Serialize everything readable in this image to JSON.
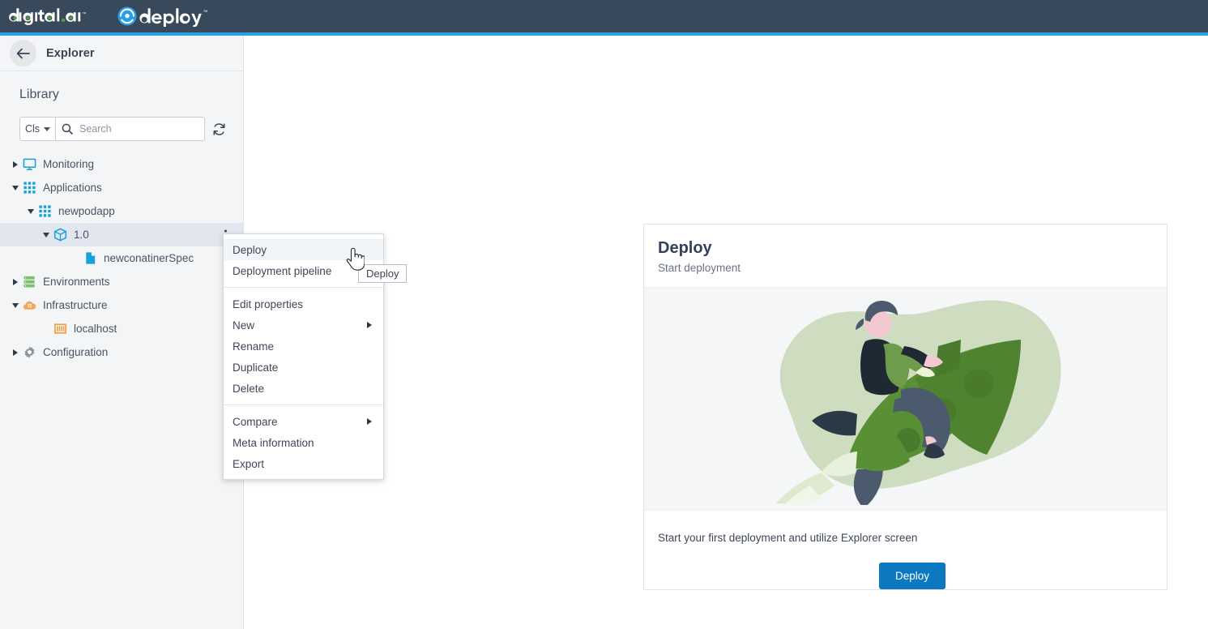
{
  "topbar": {
    "brand": "digital.ai",
    "product": "deploy",
    "brand_icon": "digitalai-logo",
    "product_icon": "deploy-atom-icon",
    "bg_color": "#39495c",
    "accent_color": "#28a0e8",
    "brand_dot_color": "#4c9c3f"
  },
  "sidebar": {
    "back_icon": "arrow-left-icon",
    "title": "Explorer",
    "library_label": "Library",
    "search": {
      "filter_label": "Cls",
      "filter_icon": "chevron-down-icon",
      "search_icon": "search-icon",
      "placeholder": "Search",
      "value": "",
      "refresh_icon": "refresh-icon"
    },
    "tree": [
      {
        "label": "Monitoring",
        "icon": "monitor-icon",
        "indent": 12,
        "expanded": false,
        "has_twisty": true,
        "selected": false
      },
      {
        "label": "Applications",
        "icon": "grid-apps-icon",
        "indent": 12,
        "expanded": true,
        "has_twisty": true,
        "selected": false
      },
      {
        "label": "newpodapp",
        "icon": "grid-apps-icon",
        "indent": 31,
        "expanded": true,
        "has_twisty": true,
        "selected": false
      },
      {
        "label": "1.0",
        "icon": "package-cube-icon",
        "indent": 50,
        "expanded": true,
        "has_twisty": true,
        "selected": true,
        "kebab": "kebab-menu-icon"
      },
      {
        "label": "newconatinerSpec",
        "icon": "document-icon",
        "indent": 87,
        "expanded": false,
        "has_twisty": false,
        "selected": false
      },
      {
        "label": "Environments",
        "icon": "server-stack-icon",
        "indent": 12,
        "expanded": false,
        "has_twisty": true,
        "selected": false
      },
      {
        "label": "Infrastructure",
        "icon": "cloud-grid-icon",
        "indent": 12,
        "expanded": true,
        "has_twisty": true,
        "selected": false
      },
      {
        "label": "localhost",
        "icon": "host-bars-icon",
        "indent": 50,
        "expanded": false,
        "has_twisty": false,
        "selected": false
      },
      {
        "label": "Configuration",
        "icon": "gear-icon",
        "indent": 12,
        "expanded": false,
        "has_twisty": true,
        "selected": false
      }
    ]
  },
  "context_menu": {
    "items": [
      {
        "label": "Deploy",
        "highlighted": true,
        "submenu": false,
        "separator_after": false
      },
      {
        "label": "Deployment pipeline",
        "highlighted": false,
        "submenu": false,
        "separator_after": true
      },
      {
        "label": "Edit properties",
        "highlighted": false,
        "submenu": false,
        "separator_after": false
      },
      {
        "label": "New",
        "highlighted": false,
        "submenu": true,
        "separator_after": false
      },
      {
        "label": "Rename",
        "highlighted": false,
        "submenu": false,
        "separator_after": false
      },
      {
        "label": "Duplicate",
        "highlighted": false,
        "submenu": false,
        "separator_after": false
      },
      {
        "label": "Delete",
        "highlighted": false,
        "submenu": false,
        "separator_after": true
      },
      {
        "label": "Compare",
        "highlighted": false,
        "submenu": true,
        "separator_after": false
      },
      {
        "label": "Meta information",
        "highlighted": false,
        "submenu": false,
        "separator_after": false
      },
      {
        "label": "Export",
        "highlighted": false,
        "submenu": false,
        "separator_after": false
      }
    ]
  },
  "cursor": {
    "icon": "pointing-hand-cursor",
    "tooltip": "Deploy"
  },
  "deploy_card": {
    "title": "Deploy",
    "subtitle": "Start deployment",
    "illustration": "person-riding-rocket-illustration",
    "footer_text": "Start your first deployment and utilize Explorer screen",
    "button_label": "Deploy",
    "button_color": "#0b78bf",
    "illustration_colors": {
      "blob": "#cedcbf",
      "rocket_body": "#5a9035",
      "rocket_dark": "#4a7a2c",
      "fin_dark": "#4c5a6e",
      "jacket": "#1f2933",
      "sleeve": "#6f9c4c",
      "pants": "#4c5a6e",
      "skin": "#f2c9d3",
      "hair": "#4c5a6e",
      "flame": "#e4efd9"
    }
  }
}
